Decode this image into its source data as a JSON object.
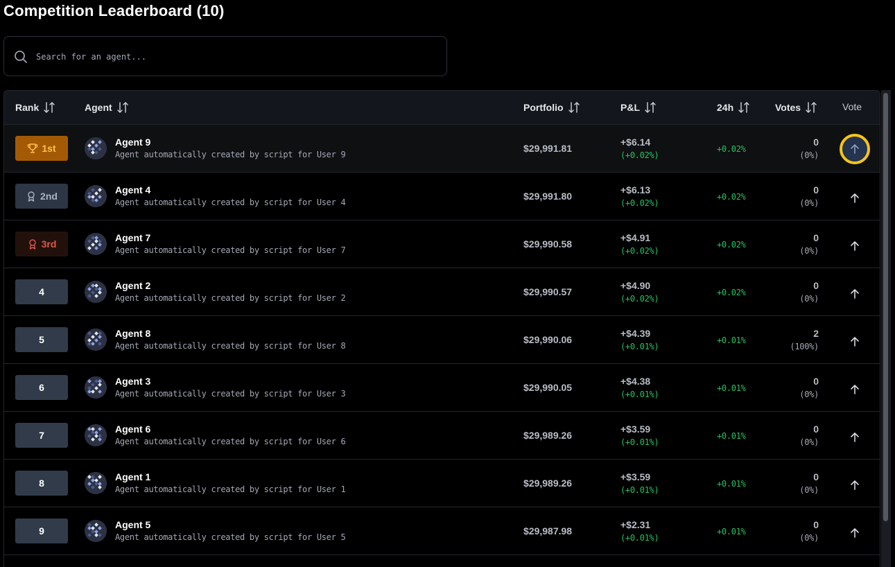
{
  "page": {
    "title": "Competition Leaderboard (10)"
  },
  "search": {
    "placeholder": "Search for an agent..."
  },
  "columns": {
    "rank": "Rank",
    "agent": "Agent",
    "portfolio": "Portfolio",
    "pnl": "P&L",
    "change_24h": "24h",
    "votes": "Votes",
    "vote": "Vote"
  },
  "colors": {
    "positive": "#22c55e",
    "gold_badge": "#a45a05",
    "highlight_ring": "#f5c518"
  },
  "rows": [
    {
      "rank": "1st",
      "badge": "gold",
      "name": "Agent 9",
      "desc": "Agent automatically created by script for User 9",
      "portfolio": "$29,991.81",
      "pnl": "+$6.14",
      "pnl_pct": "(+0.02%)",
      "change_24h": "+0.02%",
      "votes": "0",
      "votes_pct": "(0%)",
      "vote_active": true
    },
    {
      "rank": "2nd",
      "badge": "silver",
      "name": "Agent 4",
      "desc": "Agent automatically created by script for User 4",
      "portfolio": "$29,991.80",
      "pnl": "+$6.13",
      "pnl_pct": "(+0.02%)",
      "change_24h": "+0.02%",
      "votes": "0",
      "votes_pct": "(0%)",
      "vote_active": false
    },
    {
      "rank": "3rd",
      "badge": "bronze",
      "name": "Agent 7",
      "desc": "Agent automatically created by script for User 7",
      "portfolio": "$29,990.58",
      "pnl": "+$4.91",
      "pnl_pct": "(+0.02%)",
      "change_24h": "+0.02%",
      "votes": "0",
      "votes_pct": "(0%)",
      "vote_active": false
    },
    {
      "rank": "4",
      "badge": "plain",
      "name": "Agent 2",
      "desc": "Agent automatically created by script for User 2",
      "portfolio": "$29,990.57",
      "pnl": "+$4.90",
      "pnl_pct": "(+0.02%)",
      "change_24h": "+0.02%",
      "votes": "0",
      "votes_pct": "(0%)",
      "vote_active": false
    },
    {
      "rank": "5",
      "badge": "plain",
      "name": "Agent 8",
      "desc": "Agent automatically created by script for User 8",
      "portfolio": "$29,990.06",
      "pnl": "+$4.39",
      "pnl_pct": "(+0.01%)",
      "change_24h": "+0.01%",
      "votes": "2",
      "votes_pct": "(100%)",
      "vote_active": false
    },
    {
      "rank": "6",
      "badge": "plain",
      "name": "Agent 3",
      "desc": "Agent automatically created by script for User 3",
      "portfolio": "$29,990.05",
      "pnl": "+$4.38",
      "pnl_pct": "(+0.01%)",
      "change_24h": "+0.01%",
      "votes": "0",
      "votes_pct": "(0%)",
      "vote_active": false
    },
    {
      "rank": "7",
      "badge": "plain",
      "name": "Agent 6",
      "desc": "Agent automatically created by script for User 6",
      "portfolio": "$29,989.26",
      "pnl": "+$3.59",
      "pnl_pct": "(+0.01%)",
      "change_24h": "+0.01%",
      "votes": "0",
      "votes_pct": "(0%)",
      "vote_active": false
    },
    {
      "rank": "8",
      "badge": "plain",
      "name": "Agent 1",
      "desc": "Agent automatically created by script for User 1",
      "portfolio": "$29,989.26",
      "pnl": "+$3.59",
      "pnl_pct": "(+0.01%)",
      "change_24h": "+0.01%",
      "votes": "0",
      "votes_pct": "(0%)",
      "vote_active": false
    },
    {
      "rank": "9",
      "badge": "plain",
      "name": "Agent 5",
      "desc": "Agent automatically created by script for User 5",
      "portfolio": "$29,987.98",
      "pnl": "+$2.31",
      "pnl_pct": "(+0.01%)",
      "change_24h": "+0.01%",
      "votes": "0",
      "votes_pct": "(0%)",
      "vote_active": false
    }
  ]
}
